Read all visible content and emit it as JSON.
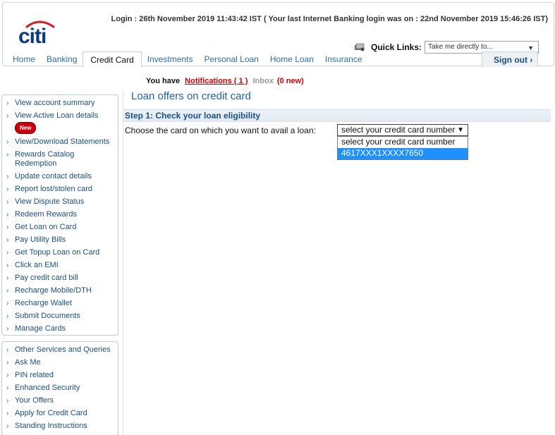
{
  "header": {
    "logo_text": "citi",
    "login_info": "Login : 26th November 2019 11:43:42 IST ( Your last Internet Banking login was on : 22nd November 2019 15:46:26 IST)",
    "quick_links_label": "Quick Links:",
    "quick_links_placeholder": "Take me directly to...",
    "sign_out": "Sign out ›"
  },
  "nav": {
    "items": [
      "Home",
      "Banking",
      "Credit Card",
      "Investments",
      "Personal Loan",
      "Home Loan",
      "Insurance"
    ],
    "active": "Credit Card"
  },
  "notifications": {
    "prefix": "You have",
    "link": "Notifications ( 1 )",
    "inbox": "Inbox",
    "inbox_new": "(0 new)"
  },
  "sidebar": {
    "group1": [
      "View account summary",
      "View Active Loan details",
      "View/Download Statements",
      "Rewards Catalog Redemption",
      "Update contact details",
      "Report lost/stolen card",
      "View Dispute Status",
      "Redeem Rewards",
      "Get Loan on Card",
      "Pay Utility Bills",
      "Get Topup Loan on Card",
      "Click an EMI",
      "Pay credit card bill",
      "Recharge Mobile/DTH",
      "Recharge Wallet",
      "Submit Documents",
      "Manage Cards"
    ],
    "new_badge": "New",
    "group2": [
      "Other Services and Queries",
      "Ask Me",
      "PIN related",
      "Enhanced Security",
      "Your Offers",
      "Apply for Credit Card",
      "Standing Instructions"
    ]
  },
  "main": {
    "title": "Loan offers on credit card",
    "step": "Step 1: Check your loan eligibility",
    "choose_label": "Choose the card on which you want to avail a loan:",
    "dropdown_value": "select your credit card number",
    "options": [
      "select your credit card number",
      "4617XXX1XXXX7650"
    ],
    "highlighted_option": "4617XXX1XXXX7650"
  },
  "colors": {
    "brand_blue": "#1f63a6",
    "link_blue": "#2a6fa8",
    "alert_red": "#d10000",
    "highlight": "#1e90ff"
  }
}
